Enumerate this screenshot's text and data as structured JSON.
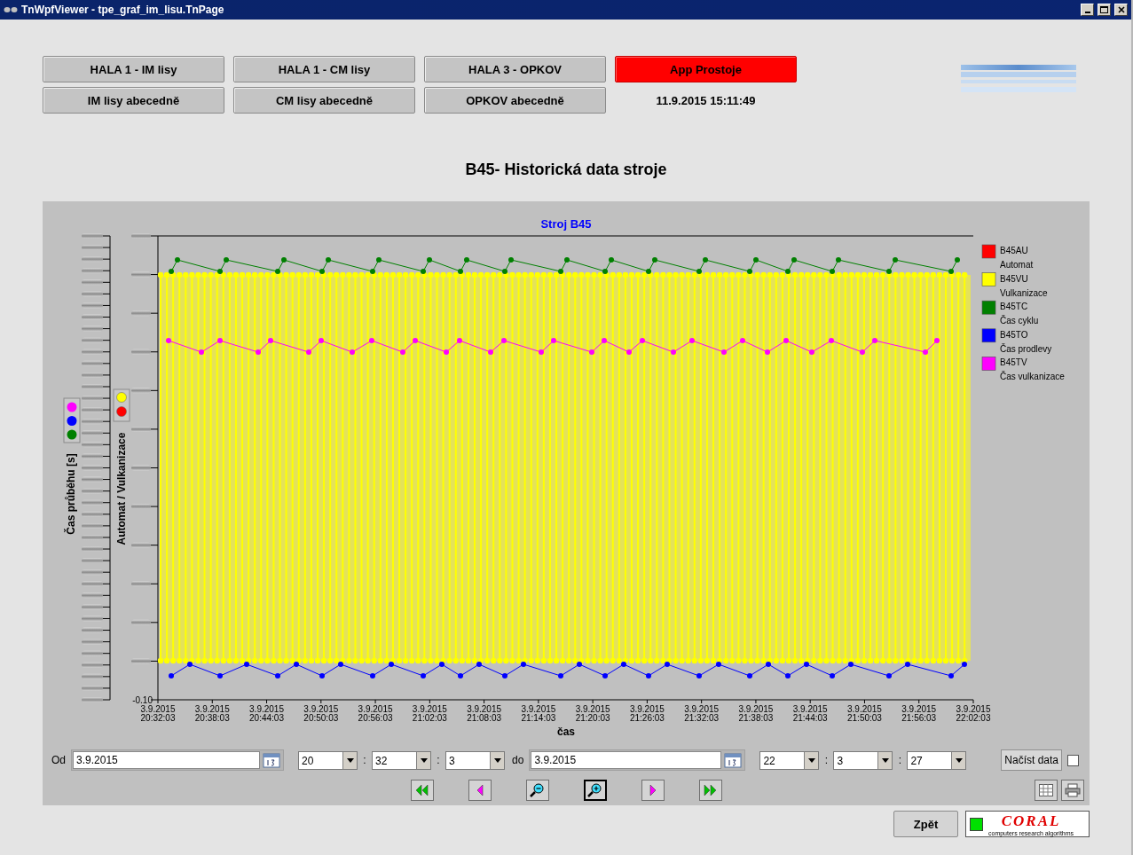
{
  "window": {
    "title": "TnWpfViewer - tpe_graf_im_lisu.TnPage"
  },
  "nav_buttons": [
    {
      "label": "HALA 1 - IM lisy",
      "kind": "normal"
    },
    {
      "label": "HALA 1 - CM lisy",
      "kind": "normal"
    },
    {
      "label": "HALA 3 - OPKOV",
      "kind": "normal"
    },
    {
      "label": "App Prostoje",
      "kind": "alert"
    },
    {
      "label": "IM lisy abecedně",
      "kind": "normal"
    },
    {
      "label": "CM lisy abecedně",
      "kind": "normal"
    },
    {
      "label": "OPKOV abecedně",
      "kind": "normal"
    }
  ],
  "timestamp": "11.9.2015 15:11:49",
  "page_title": "B45- Historická data stroje",
  "chart": {
    "title": "Stroj B45",
    "y_left_label": "Čas průběhu [s]",
    "y_right_label": "Automat / Vulkanizace",
    "y_min_label": "-0.10",
    "x_label": "čas",
    "x_ticks": [
      {
        "date": "3.9.2015",
        "time": "20:32:03"
      },
      {
        "date": "3.9.2015",
        "time": "20:38:03"
      },
      {
        "date": "3.9.2015",
        "time": "20:44:03"
      },
      {
        "date": "3.9.2015",
        "time": "20:50:03"
      },
      {
        "date": "3.9.2015",
        "time": "20:56:03"
      },
      {
        "date": "3.9.2015",
        "time": "21:02:03"
      },
      {
        "date": "3.9.2015",
        "time": "21:08:03"
      },
      {
        "date": "3.9.2015",
        "time": "21:14:03"
      },
      {
        "date": "3.9.2015",
        "time": "21:20:03"
      },
      {
        "date": "3.9.2015",
        "time": "21:26:03"
      },
      {
        "date": "3.9.2015",
        "time": "21:32:03"
      },
      {
        "date": "3.9.2015",
        "time": "21:38:03"
      },
      {
        "date": "3.9.2015",
        "time": "21:44:03"
      },
      {
        "date": "3.9.2015",
        "time": "21:50:03"
      },
      {
        "date": "3.9.2015",
        "time": "21:56:03"
      },
      {
        "date": "3.9.2015",
        "time": "22:02:03"
      }
    ],
    "legend": [
      {
        "code": "B45AU",
        "name": "Automat",
        "color": "#ff0000"
      },
      {
        "code": "B45VU",
        "name": "Vulkanizace",
        "color": "#ffff00"
      },
      {
        "code": "B45TC",
        "name": "Čas cyklu",
        "color": "#008000"
      },
      {
        "code": "B45TO",
        "name": "Čas prodlevy",
        "color": "#0000ff"
      },
      {
        "code": "B45TV",
        "name": "Čas vulkanizace",
        "color": "#ff00ff"
      }
    ]
  },
  "from": {
    "label": "Od",
    "date": "3.9.2015",
    "time": [
      "20",
      "32",
      "3"
    ],
    "separators": [
      ":",
      ":"
    ]
  },
  "to": {
    "label": "do",
    "date": "3.9.2015",
    "time": [
      "22",
      "3",
      "27"
    ],
    "separators": [
      ":",
      ":"
    ]
  },
  "load_button": {
    "label": "Načíst data"
  },
  "auto_checkbox": {
    "checked": false
  },
  "back_button": {
    "label": "Zpět"
  },
  "status_ok": true,
  "logo": {
    "name": "CORAL",
    "tagline": "computers research algorithms"
  }
}
